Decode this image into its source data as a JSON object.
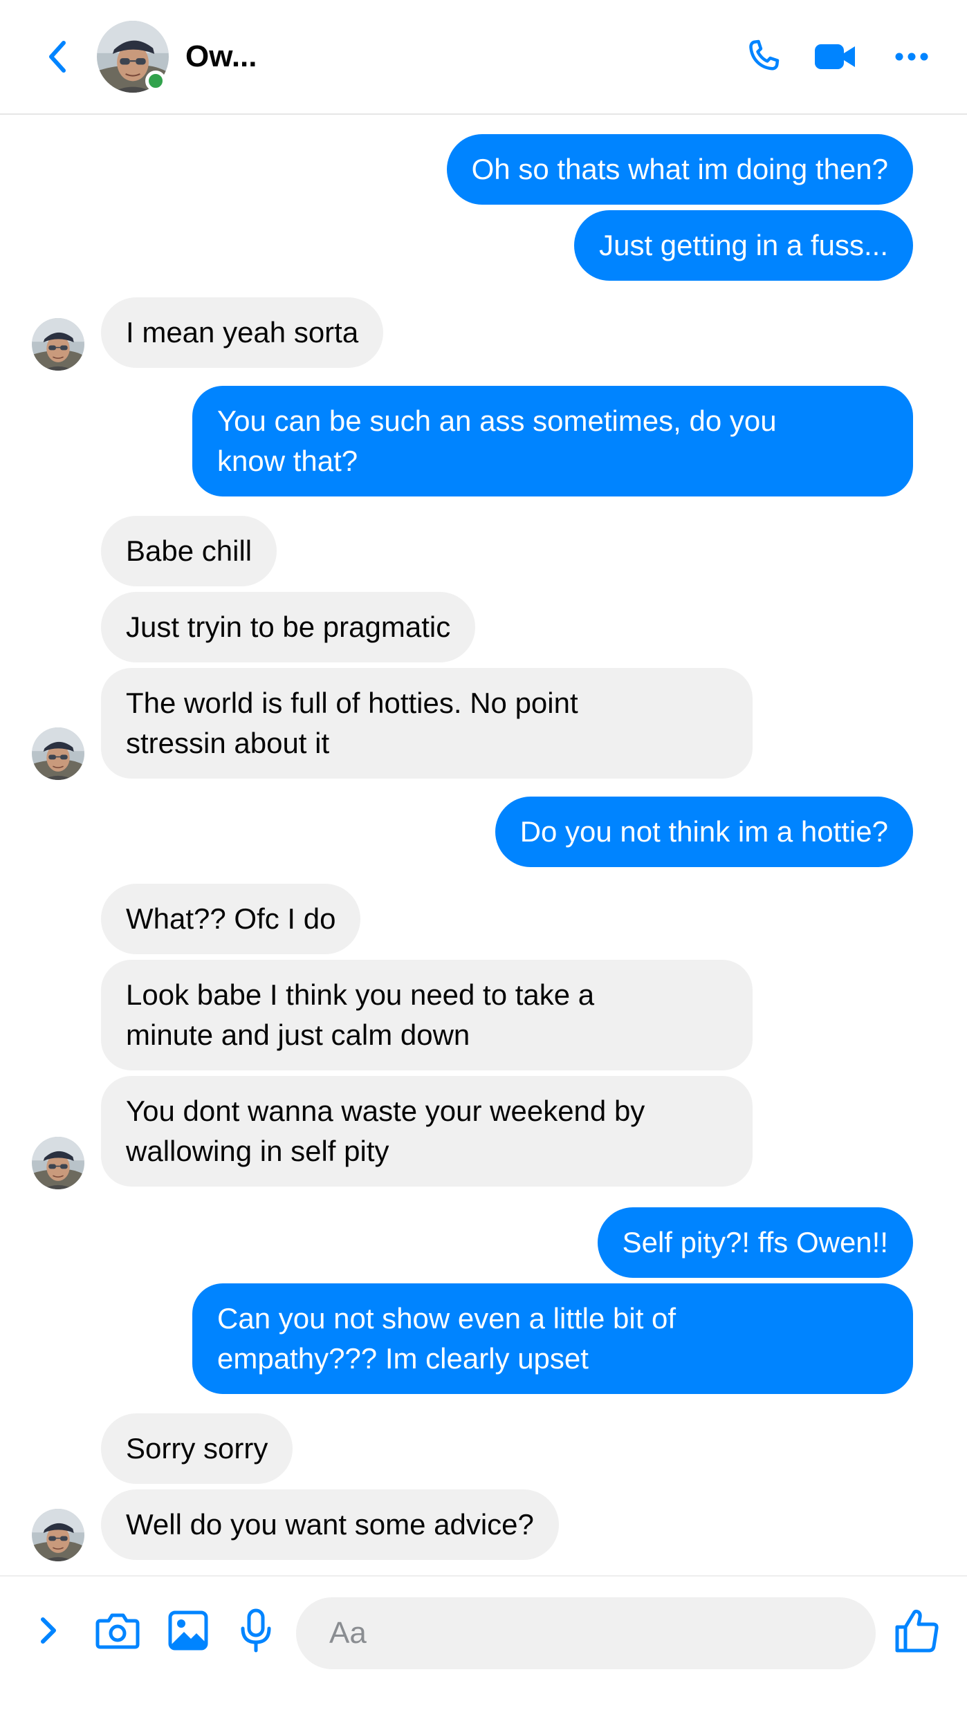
{
  "header": {
    "contact_name": "Ow...",
    "online": true
  },
  "colors": {
    "accent": "#0084ff",
    "incoming_bubble": "#f0f0f0",
    "online": "#31a24c"
  },
  "icons": {
    "back": "chevron-left-icon",
    "call": "phone-icon",
    "video": "video-camera-icon",
    "more": "more-dots-icon",
    "expand": "chevron-right-icon",
    "camera": "camera-icon",
    "gallery": "image-icon",
    "mic": "microphone-icon",
    "like": "thumbs-up-icon"
  },
  "messages": [
    {
      "sender": "me",
      "text": "Oh so thats what im doing then?"
    },
    {
      "sender": "me",
      "text": "Just getting in a fuss..."
    },
    {
      "sender": "them",
      "text": "I mean yeah sorta"
    },
    {
      "sender": "me",
      "text": "You can be such an ass sometimes, do you\nknow that?"
    },
    {
      "sender": "them",
      "text": "Babe chill"
    },
    {
      "sender": "them",
      "text": "Just tryin to be pragmatic"
    },
    {
      "sender": "them",
      "text": "The world is full of hotties. No point\nstressin about it"
    },
    {
      "sender": "me",
      "text": "Do you not think im a hottie?"
    },
    {
      "sender": "them",
      "text": "What?? Ofc I do"
    },
    {
      "sender": "them",
      "text": "Look babe I think you need to take a\nminute and just calm down"
    },
    {
      "sender": "them",
      "text": "You dont wanna waste your weekend by\nwallowing in self pity"
    },
    {
      "sender": "me",
      "text": "Self pity?! ffs Owen!!"
    },
    {
      "sender": "me",
      "text": "Can you not show even a little bit of\nempathy??? Im clearly upset"
    },
    {
      "sender": "them",
      "text": "Sorry sorry"
    },
    {
      "sender": "them",
      "text": "Well do you want some advice?"
    }
  ],
  "composer": {
    "placeholder": "Aa",
    "value": ""
  }
}
